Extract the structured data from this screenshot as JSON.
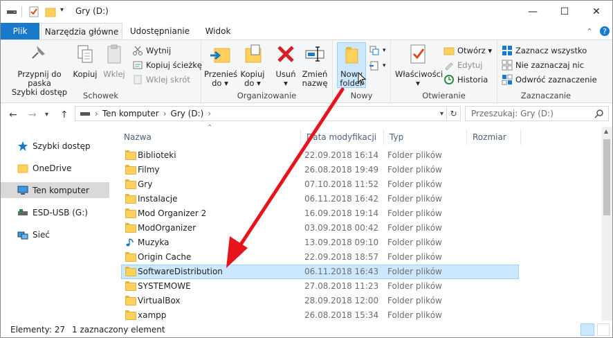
{
  "window": {
    "title": "Gry (D:)"
  },
  "tabs": {
    "file": "Plik",
    "drive_tools": "Narzędzia główne",
    "share": "Udostępnianie",
    "view": "Widok"
  },
  "ribbon": {
    "clipboard": {
      "label": "Schowek",
      "pin_line1": "Przypnij do paska",
      "pin_line2": "Szybki dostęp",
      "copy": "Kopiuj",
      "paste": "Wklej",
      "cut": "Wytnij",
      "copy_path": "Kopiuj ścieżkę",
      "paste_shortcut": "Wklej skrót"
    },
    "organize": {
      "label": "Organizowanie",
      "move_line1": "Przenieś",
      "move_line2": "do ▾",
      "copy_line1": "Kopiuj",
      "copy_line2": "do ▾",
      "delete_line1": "Usuń",
      "delete_line2": "▾",
      "rename_line1": "Zmień",
      "rename_line2": "nazwę"
    },
    "new": {
      "label": "Nowy",
      "newfolder_line1": "Nowy",
      "newfolder_line2": "folder"
    },
    "open": {
      "label": "Otwieranie",
      "props_line1": "Właściwości",
      "props_line2": "▾",
      "open": "Otwórz ▾",
      "edit": "Edytuj",
      "history": "Historia"
    },
    "select": {
      "label": "Zaznaczanie",
      "select_all": "Zaznacz wszystko",
      "select_none": "Nie zaznaczaj nic",
      "invert": "Odwróć zaznaczenie"
    }
  },
  "address": {
    "path_root": "Ten komputer",
    "path_sep": "›",
    "path_drive": "Gry (D:)",
    "search_placeholder": "Przeszukaj: Gry (D:)"
  },
  "nav": [
    {
      "label": "Szybki dostęp",
      "icon": "star-icon"
    },
    {
      "label": "OneDrive",
      "icon": "folder-icon"
    },
    {
      "label": "Ten komputer",
      "icon": "computer-icon"
    },
    {
      "label": "ESD-USB (G:)",
      "icon": "usb-drive-icon"
    },
    {
      "label": "Sieć",
      "icon": "network-icon"
    }
  ],
  "columns": {
    "name": "Nazwa",
    "date": "Data modyfikacji",
    "type": "Typ",
    "size": "Rozmiar"
  },
  "files": [
    {
      "name": "Biblioteki",
      "date": "22.09.2018 16:14",
      "type": "Folder plików"
    },
    {
      "name": "Filmy",
      "date": "26.08.2018 19:49",
      "type": "Folder plików"
    },
    {
      "name": "Gry",
      "date": "07.10.2018 11:52",
      "type": "Folder plików"
    },
    {
      "name": "Instalacje",
      "date": "06.11.2018 16:42",
      "type": "Folder plików"
    },
    {
      "name": "Mod Organizer 2",
      "date": "16.09.2018 19:14",
      "type": "Folder plików"
    },
    {
      "name": "ModOrganizer",
      "date": "03.09.2018 00:42",
      "type": "Folder plików"
    },
    {
      "name": "Muzyka",
      "date": "13.09.2018 09:10",
      "type": "Folder plików"
    },
    {
      "name": "Origin Cache",
      "date": "22.09.2018 18:57",
      "type": "Folder plików"
    },
    {
      "name": "SoftwareDistribution",
      "date": "06.11.2018 16:43",
      "type": "Folder plików"
    },
    {
      "name": "SYSTEMOWE",
      "date": "27.08.2018 11:23",
      "type": "Folder plików"
    },
    {
      "name": "VirtualBox",
      "date": "28.09.2018 12:00",
      "type": "Folder plików"
    },
    {
      "name": "xampp",
      "date": "26.08.2018 15:34",
      "type": "Folder plików"
    }
  ],
  "status": {
    "count": "Elementy: 27",
    "selected": "1 zaznaczony element"
  },
  "colors": {
    "accent": "#1979ca",
    "selection": "#cce8ff",
    "arrow": "#e8141b"
  }
}
